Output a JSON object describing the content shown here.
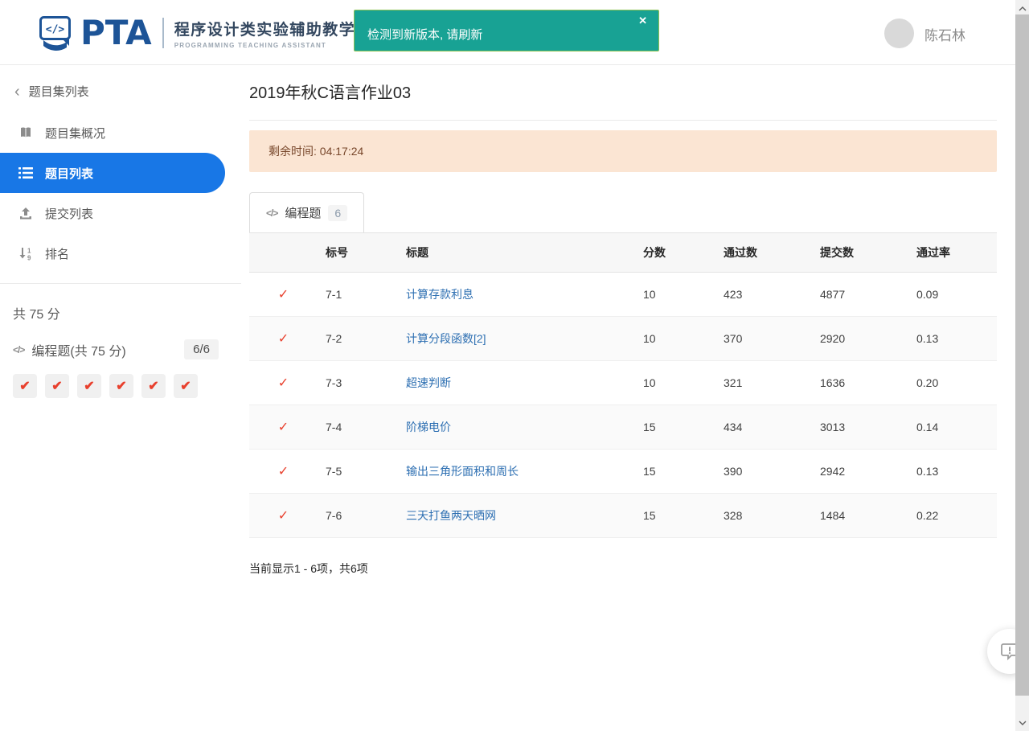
{
  "header": {
    "logo": {
      "pta": "PTA",
      "cn_name": "程序设计类实验辅助教学平台",
      "en_name": "PROGRAMMING TEACHING ASSISTANT"
    },
    "notification": {
      "text": "检测到新版本, 请刷新"
    },
    "user": {
      "name": "陈石林"
    }
  },
  "sidebar": {
    "back": {
      "label": "题目集列表"
    },
    "items": [
      {
        "label": "题目集概况",
        "icon": "book-icon",
        "active": false
      },
      {
        "label": "题目列表",
        "icon": "list-icon",
        "active": true
      },
      {
        "label": "提交列表",
        "icon": "upload-icon",
        "active": false
      },
      {
        "label": "排名",
        "icon": "sort-numeric-icon",
        "active": false
      }
    ],
    "summary": {
      "total": "共 75 分",
      "section": "编程题(共 75 分)",
      "progress": "6/6",
      "checks": 6
    }
  },
  "main": {
    "title": "2019年秋C语言作业03",
    "alert": "剩余时间: 04:17:24",
    "tab": {
      "label": "编程题",
      "count": "6"
    },
    "table": {
      "headers": [
        "标号",
        "标题",
        "分数",
        "通过数",
        "提交数",
        "通过率"
      ],
      "rows": [
        {
          "id": "7-1",
          "title": "计算存款利息",
          "score": "10",
          "pass": "423",
          "submit": "4877",
          "rate": "0.09"
        },
        {
          "id": "7-2",
          "title": "计算分段函数[2]",
          "score": "10",
          "pass": "370",
          "submit": "2920",
          "rate": "0.13"
        },
        {
          "id": "7-3",
          "title": "超速判断",
          "score": "10",
          "pass": "321",
          "submit": "1636",
          "rate": "0.20"
        },
        {
          "id": "7-4",
          "title": "阶梯电价",
          "score": "15",
          "pass": "434",
          "submit": "3013",
          "rate": "0.14"
        },
        {
          "id": "7-5",
          "title": "输出三角形面积和周长",
          "score": "15",
          "pass": "390",
          "submit": "2942",
          "rate": "0.13"
        },
        {
          "id": "7-6",
          "title": "三天打鱼两天晒网",
          "score": "15",
          "pass": "328",
          "submit": "1484",
          "rate": "0.22"
        }
      ]
    },
    "footer": "当前显示1 - 6项，共6项"
  },
  "icons": {
    "back_chevron": "‹",
    "close": "✕",
    "code": "</>",
    "check": "✓",
    "check_bold": "✔"
  },
  "colors": {
    "notification_teal": "#18A294",
    "notification_border_green": "#8CC152",
    "active_item_blue": "#1877E6",
    "logo_navy": "#1D5497",
    "check_red": "#E8402D",
    "link_blue": "#2D6FB2",
    "alert_bg": "#FBE5D3",
    "alert_text": "#77462A"
  }
}
